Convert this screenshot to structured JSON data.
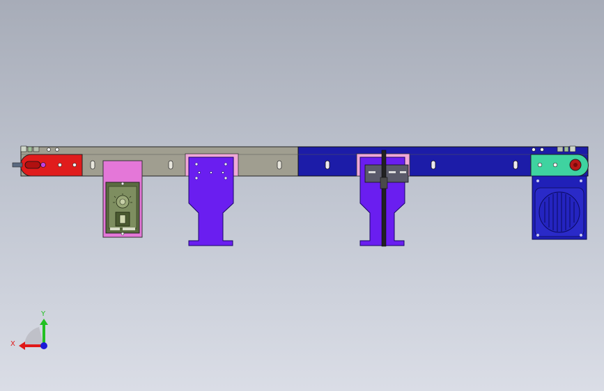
{
  "viewport": {
    "background_top": "#a7acb8",
    "background_bottom": "#dadde6"
  },
  "triad": {
    "x_label": "X",
    "y_label": "Y",
    "x_color": "#e01818",
    "y_color": "#22c022",
    "z_color": "#1a1ad8"
  },
  "colors": {
    "frame_left": "#a09e90",
    "frame_right": "#1c1ca8",
    "end_cap_left": "#e01c1c",
    "end_cap_right": "#3fd3a0",
    "control_box": "#e477d8",
    "control_panel": "#5a6b40",
    "leg_left": "#6a1ef0",
    "leg_right": "#6a1ef0",
    "motor": "#2020b8",
    "bracket_pink": "#f0a8d8"
  },
  "parts": [
    "conveyor-frame-left",
    "conveyor-frame-right",
    "drive-end-cap",
    "idler-end-cap",
    "speed-controller-box",
    "support-leg-left",
    "support-leg-right",
    "drive-motor"
  ]
}
